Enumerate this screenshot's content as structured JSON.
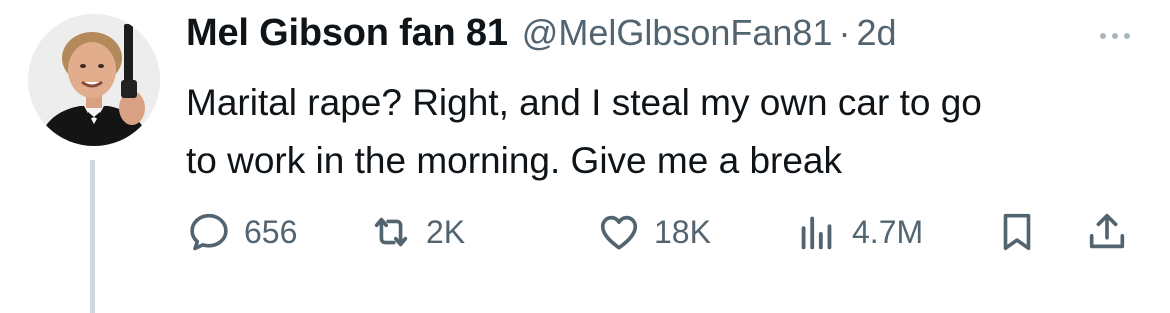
{
  "tweet": {
    "author_name": "Mel Gibson fan 81",
    "handle": "@MelGlbsonFan81",
    "separator": "·",
    "time": "2d",
    "text_lines": [
      "Marital rape? Right, and I steal my own car to go",
      "to work in the morning. Give me a break"
    ]
  },
  "actions": {
    "replies": "656",
    "retweets": "2K",
    "likes": "18K",
    "views": "4.7M"
  },
  "icons": {
    "reply": "speech-bubble-icon",
    "retweet": "retweet-arrows-icon",
    "like": "heart-icon",
    "views": "bar-chart-icon",
    "bookmark": "bookmark-icon",
    "share": "share-upload-icon",
    "more": "more-horizontal-icon"
  },
  "colors": {
    "text": "#0f1419",
    "secondary": "#536471",
    "thread_line": "#cfd9de"
  }
}
